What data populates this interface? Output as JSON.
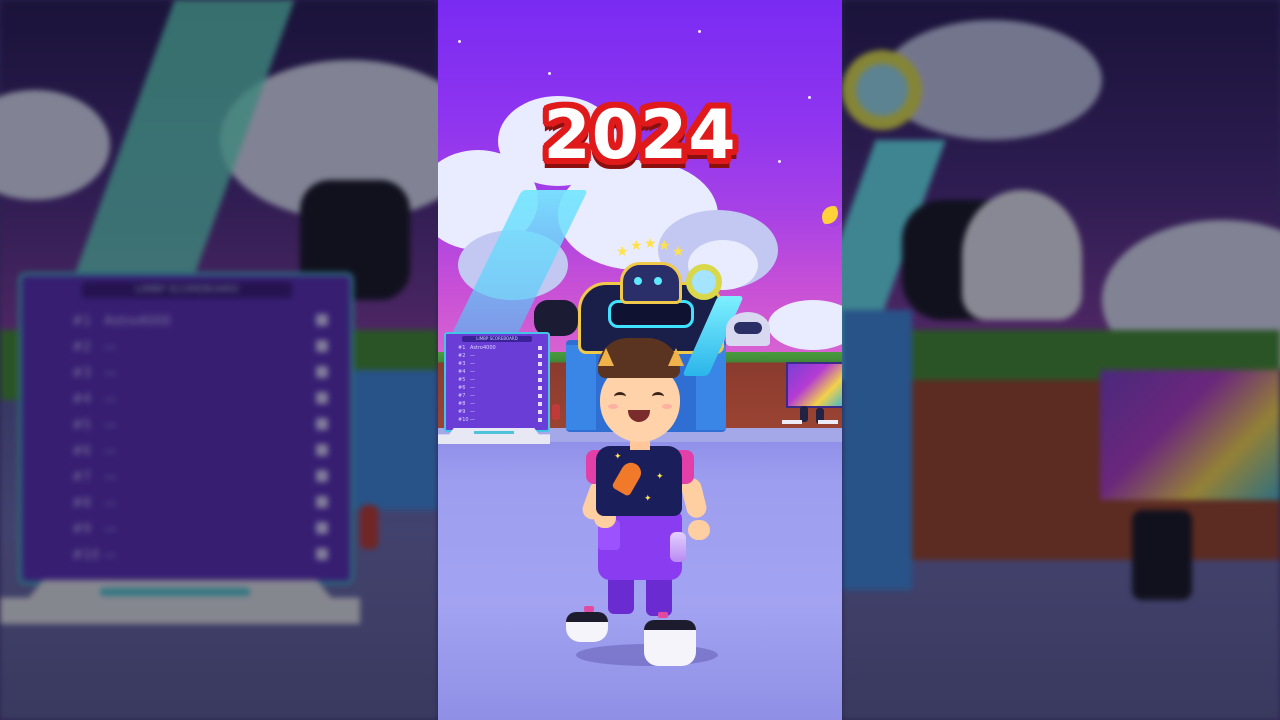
{
  "overlay": {
    "year": "2024"
  },
  "scene": {
    "leaderboard": {
      "title": "LIMBP SCOREBOARD",
      "rows": [
        {
          "rank": "#1",
          "name": "Astro4000"
        },
        {
          "rank": "#2",
          "name": "—"
        },
        {
          "rank": "#3",
          "name": "—"
        },
        {
          "rank": "#4",
          "name": "—"
        },
        {
          "rank": "#5",
          "name": "—"
        },
        {
          "rank": "#6",
          "name": "—"
        },
        {
          "rank": "#7",
          "name": "—"
        },
        {
          "rank": "#8",
          "name": "—"
        },
        {
          "rank": "#9",
          "name": "—"
        },
        {
          "rank": "#10",
          "name": "—"
        }
      ]
    }
  },
  "colors": {
    "title_fill": "#ffffff",
    "title_outline": "#e01a1a",
    "sky_top": "#7a2bf2",
    "ground": "#a3a3f2"
  },
  "icons": [
    "thumbs-up-icon",
    "star-icon",
    "rocket-icon"
  ]
}
